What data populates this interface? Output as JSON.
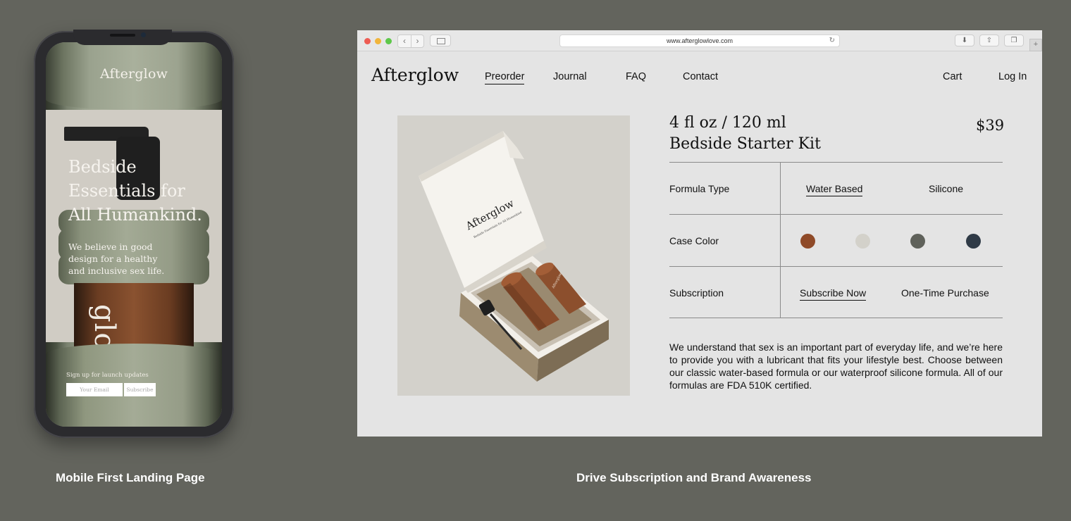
{
  "mobile": {
    "logo": "Afterglow",
    "hero_lines": [
      "Bedside",
      "Essentials for",
      "All Humankind."
    ],
    "subtext_lines": [
      "We believe in good",
      "design for a healthy",
      "and inclusive sex life."
    ],
    "bottle_text": "glow",
    "signup_label": "Sign up for launch updates",
    "email_placeholder": "Your Email",
    "subscribe_label": "Subscribe"
  },
  "captions": {
    "left": "Mobile First Landing Page",
    "right": "Drive Subscription and Brand Awareness"
  },
  "browser": {
    "url": "www.afterglowlove.com",
    "icons": {
      "back": "chevron-left-icon",
      "forward": "chevron-right-icon",
      "sidebar": "sidebar-icon",
      "reload": "reload-icon",
      "download": "download-icon",
      "share": "share-icon",
      "tabs": "tabs-icon",
      "new_tab": "plus-icon"
    }
  },
  "site": {
    "logo": "Afterglow",
    "nav": [
      "Preorder",
      "Journal",
      "FAQ",
      "Contact"
    ],
    "active_nav": "Preorder",
    "cart": "Cart",
    "login": "Log In",
    "box_logo": "Afterglow",
    "box_tagline": "Bedside Essentials for All Humankind",
    "product": {
      "size": "4 fl oz / 120 ml",
      "name": "Bedside Starter Kit",
      "price": "$39"
    },
    "options": {
      "formula": {
        "label": "Formula Type",
        "choices": [
          "Water Based",
          "Silicone"
        ],
        "selected": "Water Based"
      },
      "case_color": {
        "label": "Case Color",
        "colors": [
          "#8f4a28",
          "#d3d1ca",
          "#5f615a",
          "#2f3a46"
        ]
      },
      "subscription": {
        "label": "Subscription",
        "choices": [
          "Subscribe Now",
          "One-Time Purchase"
        ],
        "selected": "Subscribe Now"
      }
    },
    "description": "We understand that sex is an important part of everyday life, and we’re here to provide you with a lubricant that fits your lifestyle best. Choose between our classic water-based formula or our waterproof silicone formula. All of our formulas are FDA 510K certified."
  }
}
